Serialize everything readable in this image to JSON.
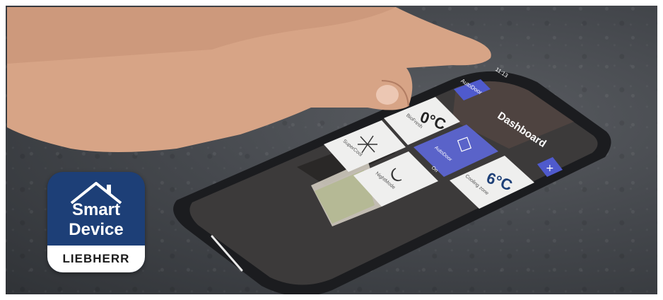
{
  "app_icon": {
    "line1": "Smart",
    "line2": "Device",
    "brand": "LIEBHERR",
    "color": "#1d3f77"
  },
  "phone_screen": {
    "title": "Dashboard",
    "time": "11:13",
    "autodoor_chip": "AutoDoor",
    "tiles": [
      {
        "name": "BioFresh",
        "value": "0°C"
      },
      {
        "name": "SuperCool",
        "value": ""
      },
      {
        "name": "AutoDoor",
        "value": "On"
      },
      {
        "name": "NightMode",
        "value": ""
      },
      {
        "name": "Cooling zone",
        "value": "6°C"
      }
    ],
    "add_label": "+"
  }
}
